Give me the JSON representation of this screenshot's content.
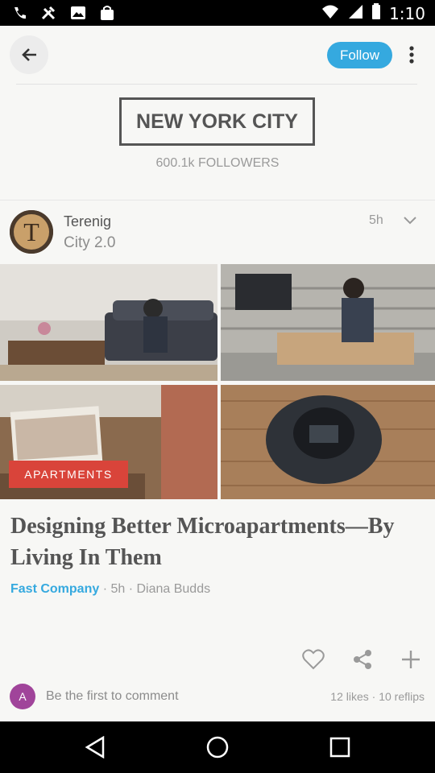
{
  "status_bar": {
    "time": "1:10"
  },
  "header": {
    "follow_label": "Follow"
  },
  "board": {
    "title": "NEW YORK CITY",
    "followers": "600.1k FOLLOWERS"
  },
  "post": {
    "poster_name": "Terenig",
    "poster_subtitle": "City 2.0",
    "avatar_letter": "T",
    "time": "5h",
    "tag": "APARTMENTS",
    "title": "Designing Better Microapartments—By Living In Them",
    "source": "Fast Company",
    "meta": " · 5h · Diana Budds",
    "comment_avatar_letter": "A",
    "comment_prompt": "Be the first to comment",
    "stats": "12 likes · 10 reflips"
  },
  "colors": {
    "accent": "#35a9df",
    "tag": "#d9443a",
    "background": "#f7f7f5"
  },
  "icons": [
    "back-arrow-icon",
    "more-vert-icon",
    "chevron-down-icon",
    "heart-icon",
    "share-icon",
    "plus-icon"
  ]
}
